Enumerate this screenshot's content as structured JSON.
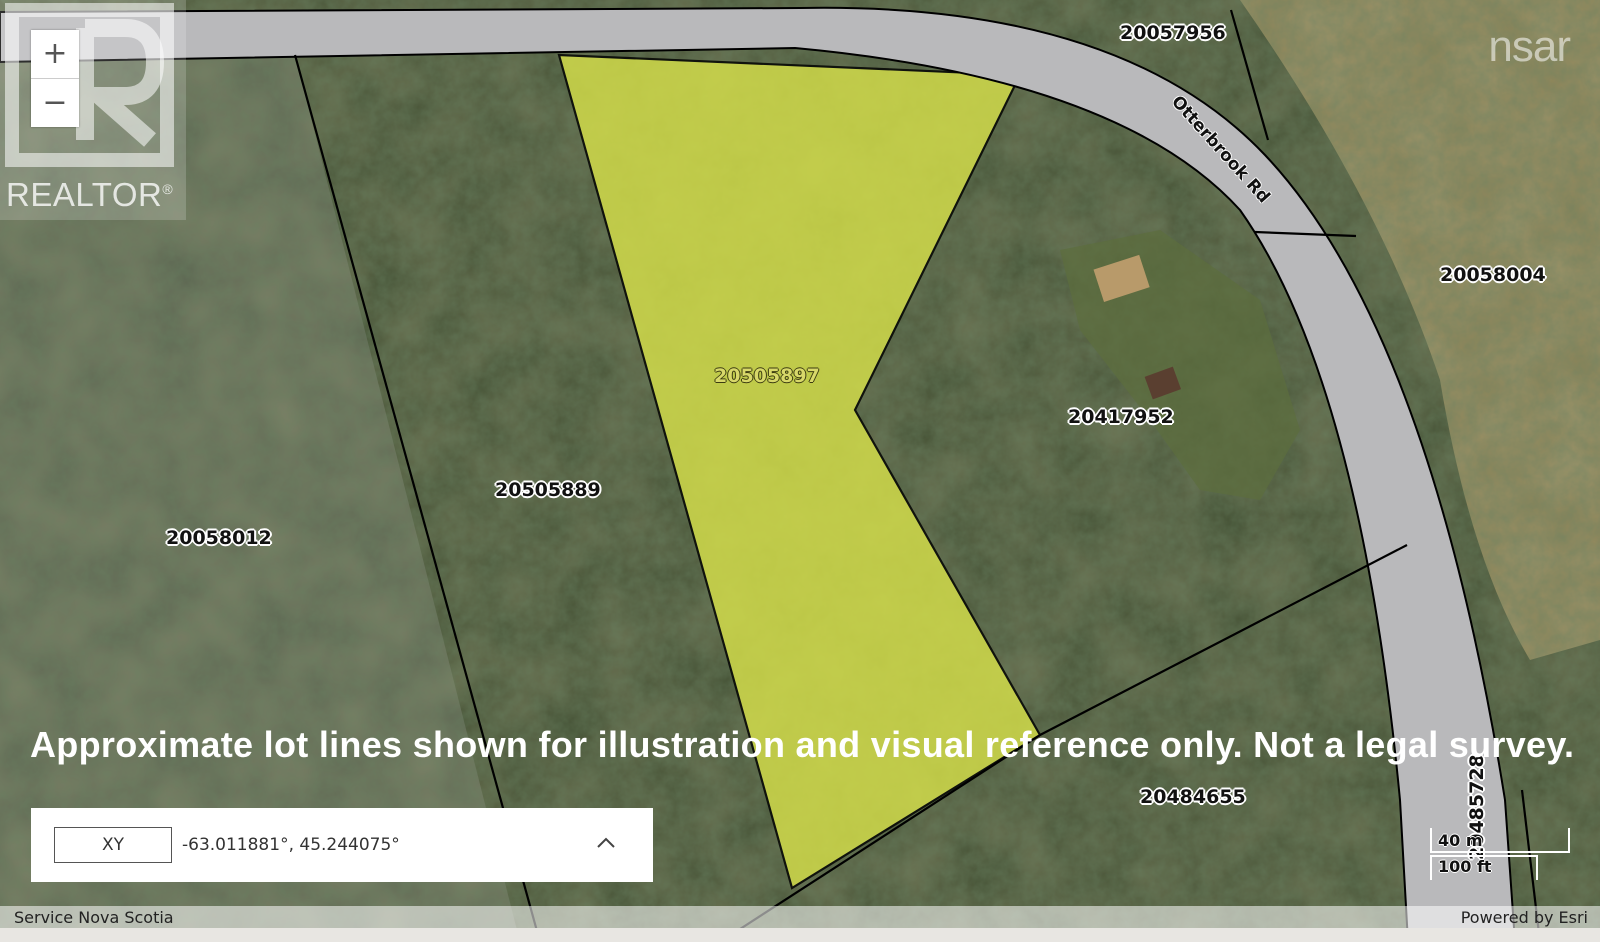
{
  "map": {
    "road_name": "Otterbrook Rd",
    "highlight_color": "#d6e04a",
    "road_color": "#b9b9bb",
    "parcels": [
      {
        "id": "p-20057956",
        "label": "20057956"
      },
      {
        "id": "p-20058004",
        "label": "20058004"
      },
      {
        "id": "p-20505897",
        "label": "20505897",
        "highlighted": true
      },
      {
        "id": "p-20417952",
        "label": "20417952"
      },
      {
        "id": "p-20505889",
        "label": "20505889"
      },
      {
        "id": "p-20058012",
        "label": "20058012"
      },
      {
        "id": "p-20484655",
        "label": "20484655"
      },
      {
        "id": "p-20485728",
        "label": "20485728"
      }
    ],
    "disclaimer": "Approximate lot lines shown for illustration and visual reference only.  Not a legal survey."
  },
  "zoom": {
    "in_label": "+",
    "out_label": "−"
  },
  "branding": {
    "realtor_logo_text": "REALTOR",
    "nsar_logo_text": "nsar"
  },
  "coordinates": {
    "mode": "XY",
    "value": "-63.011881°, 45.244075°"
  },
  "scale": {
    "metric": "40 m",
    "imperial": "100 ft"
  },
  "attribution": {
    "source": "Service Nova Scotia",
    "powered_by": "Powered by Esri"
  }
}
